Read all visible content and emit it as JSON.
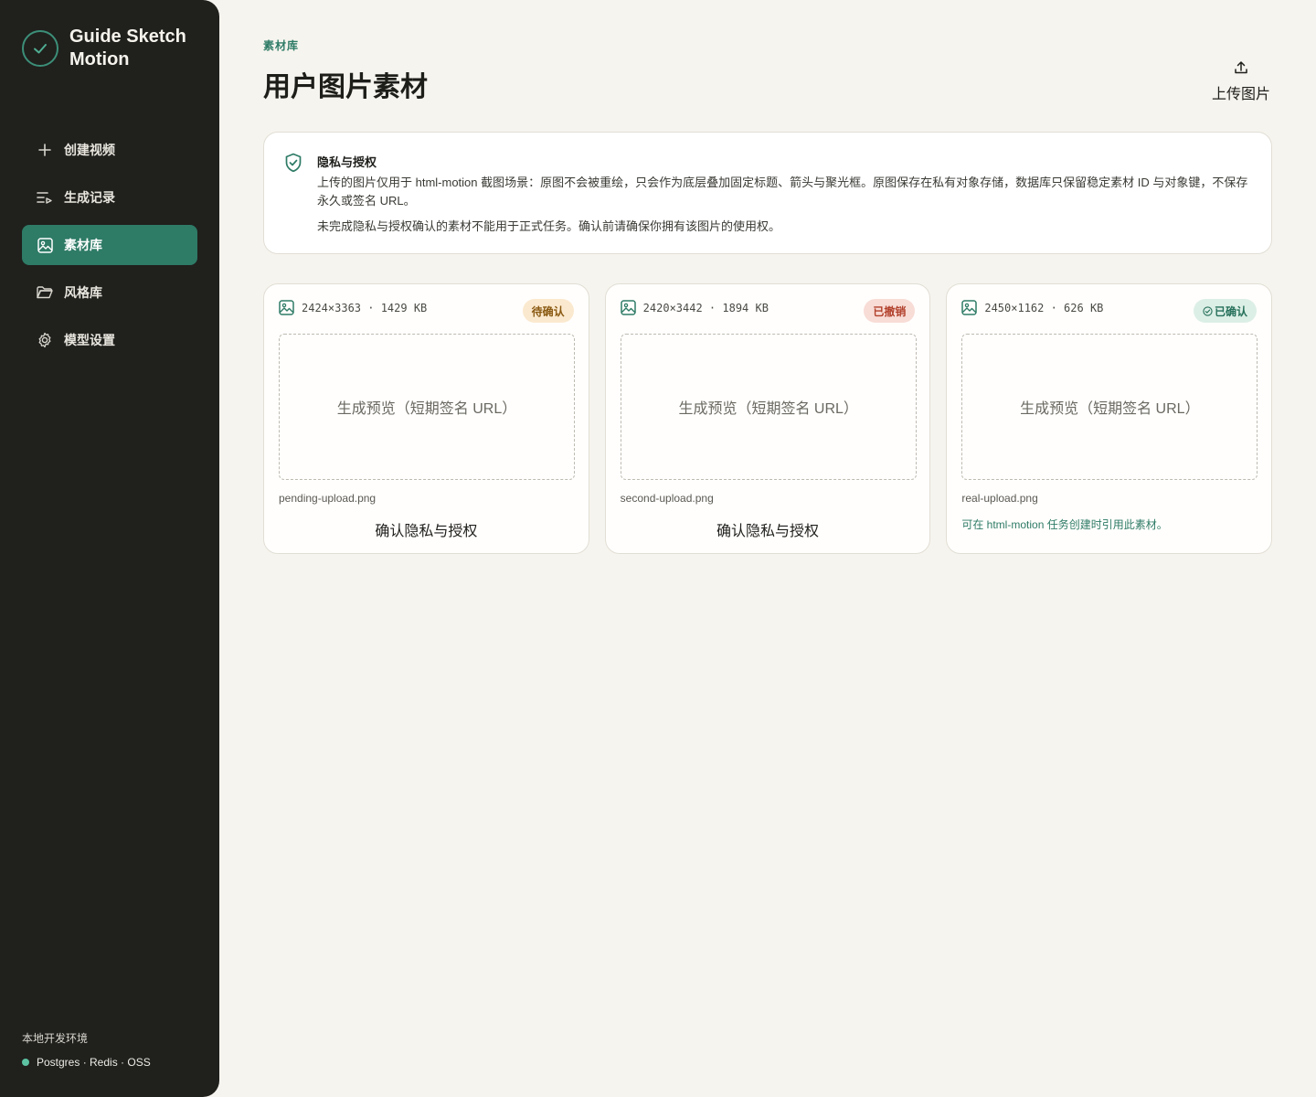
{
  "brand": {
    "name": "Guide Sketch Motion"
  },
  "nav": [
    {
      "label": "创建视频",
      "icon": "plus-icon",
      "active": false
    },
    {
      "label": "生成记录",
      "icon": "list-play-icon",
      "active": false
    },
    {
      "label": "素材库",
      "icon": "image-icon",
      "active": true
    },
    {
      "label": "风格库",
      "icon": "folder-icon",
      "active": false
    },
    {
      "label": "模型设置",
      "icon": "gear-icon",
      "active": false
    }
  ],
  "env": {
    "label": "本地开发环境",
    "services": "Postgres · Redis · OSS",
    "status_color": "#5cc2a2"
  },
  "header": {
    "eyebrow": "素材库",
    "title": "用户图片素材",
    "upload_label": "上传图片"
  },
  "privacy": {
    "title": "隐私与授权",
    "p1": "上传的图片仅用于 html-motion 截图场景：原图不会被重绘，只会作为底层叠加固定标题、箭头与聚光框。原图保存在私有对象存储，数据库只保留稳定素材 ID 与对象键，不保存永久或签名 URL。",
    "p2": "未完成隐私与授权确认的素材不能用于正式任务。确认前请确保你拥有该图片的使用权。"
  },
  "cards": [
    {
      "meta": "2424×3363 · 1429 KB",
      "badge": "待确认",
      "status": "pending",
      "preview": "生成预览（短期签名 URL）",
      "filename": "pending-upload.png",
      "action": "确认隐私与授权"
    },
    {
      "meta": "2420×3442 · 1894 KB",
      "badge": "已撤销",
      "status": "revoked",
      "preview": "生成预览（短期签名 URL）",
      "filename": "second-upload.png",
      "action": "确认隐私与授权"
    },
    {
      "meta": "2450×1162 · 626 KB",
      "badge": "已确认",
      "status": "confirmed",
      "preview": "生成预览（短期签名 URL）",
      "filename": "real-upload.png",
      "note": "可在 html-motion 任务创建时引用此素材。"
    }
  ],
  "colors": {
    "accent": "#2e7b66",
    "sidebar_bg": "#20201d",
    "page_bg": "#f6f4ee"
  }
}
